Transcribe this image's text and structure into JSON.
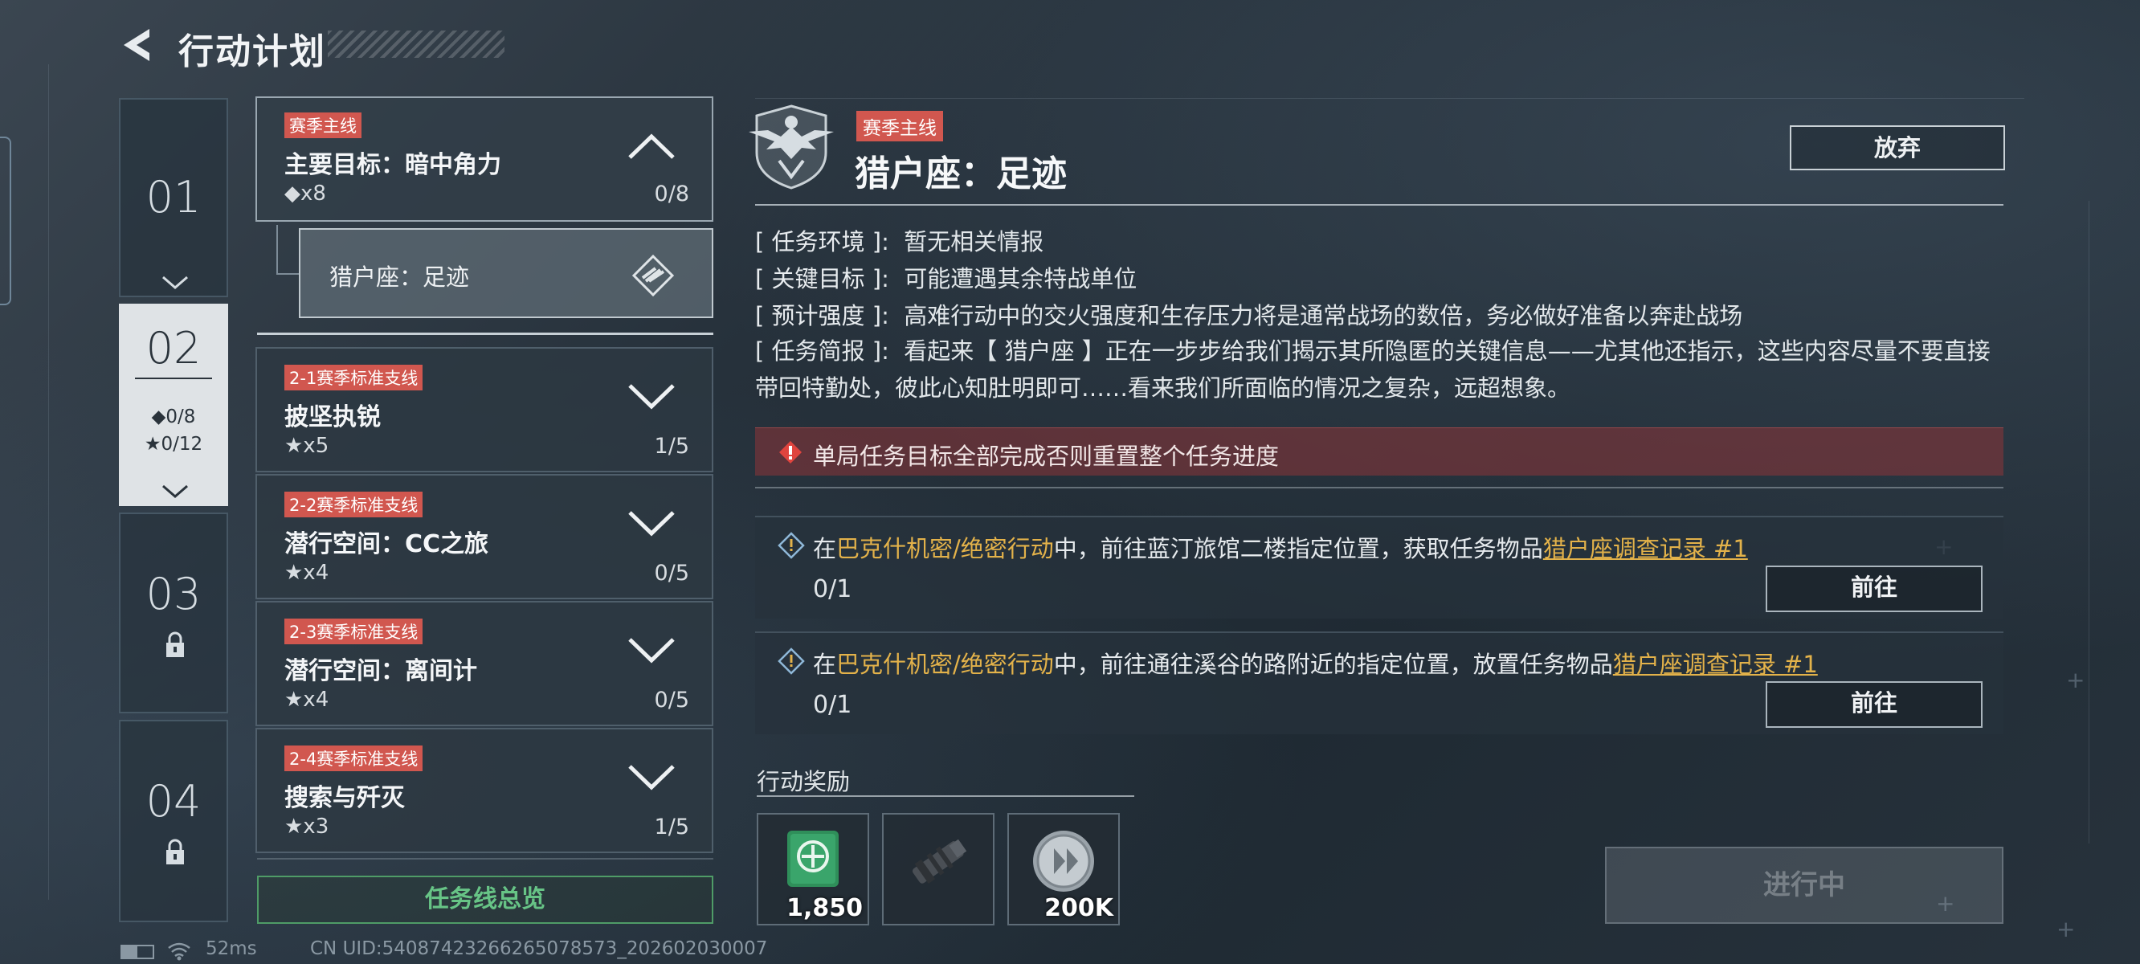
{
  "header": {
    "title": "行动计划"
  },
  "chapters": [
    {
      "num": "01",
      "state": "expandable"
    },
    {
      "num": "02",
      "state": "active",
      "diamond_stat": "◆0/8",
      "star_stat": "★0/12"
    },
    {
      "num": "03",
      "state": "locked"
    },
    {
      "num": "04",
      "state": "locked"
    }
  ],
  "missions": [
    {
      "tag": "赛季主线",
      "title": "主要目标：暗中角力",
      "count": "◆x8",
      "progress": "0/8",
      "expanded": true
    },
    {
      "tag": "2-1赛季标准支线",
      "title": "披坚执锐",
      "count": "★x5",
      "progress": "1/5"
    },
    {
      "tag": "2-2赛季标准支线",
      "title": "潜行空间：CC之旅",
      "count": "★x4",
      "progress": "0/5"
    },
    {
      "tag": "2-3赛季标准支线",
      "title": "潜行空间：离间计",
      "count": "★x4",
      "progress": "0/5"
    },
    {
      "tag": "2-4赛季标准支线",
      "title": "搜索与歼灭",
      "count": "★x3",
      "progress": "1/5"
    }
  ],
  "sub_mission": {
    "label": "猎户座：足迹"
  },
  "overview_button": "任务线总览",
  "detail": {
    "tag": "赛季主线",
    "title": "猎户座：足迹",
    "abandon_label": "放弃",
    "env_key": "[ 任务环境 ]",
    "env_val": "暂无相关情报",
    "target_key": "[ 关键目标 ]",
    "target_val": "可能遭遇其余特战单位",
    "intensity_key": "[ 预计强度 ]",
    "intensity_val": "高难行动中的交火强度和生存压力将是通常战场的数倍，务必做好准备以奔赴战场",
    "brief_key": "[ 任务简报 ]",
    "brief_val": "看起来【 猎户座 】正在一步步给我们揭示其所隐匿的关键信息——尤其他还指示，这些内容尽量不要直接带回特勤处，彼此心知肚明即可……看来我们所面临的情况之复杂，远超想象。",
    "colon": ":",
    "warning": "单局任务目标全部完成否则重置整个任务进度",
    "objectives": [
      {
        "pre": "在",
        "map": "巴克什机密/绝密行动",
        "mid": "中，前往蓝汀旅馆二楼指定位置，获取任务物品",
        "item": "猎户座调查记录 #1",
        "progress": "0/1",
        "button": "前往"
      },
      {
        "pre": "在",
        "map": "巴克什机密/绝密行动",
        "mid": "中，前往通往溪谷的路附近的指定位置，放置任务物品",
        "item": "猎户座调查记录 #1",
        "progress": "0/1",
        "button": "前往"
      }
    ],
    "reward_label": "行动奖励",
    "rewards": [
      {
        "icon": "emblem-crate-icon",
        "qty": "1,850",
        "color": "#2f8f5a"
      },
      {
        "icon": "muzzle-attachment-icon",
        "qty": ""
      },
      {
        "icon": "silver-coin-icon",
        "qty": "200K"
      }
    ],
    "status_button": "进行中"
  },
  "status_bar": {
    "ping": "52ms",
    "uid": "CN UID:54087423266265078573_202602030007"
  },
  "colors": {
    "tag_red": "#d1574f",
    "highlight_gold": "#e3b24a",
    "overview_green": "#67c486"
  }
}
